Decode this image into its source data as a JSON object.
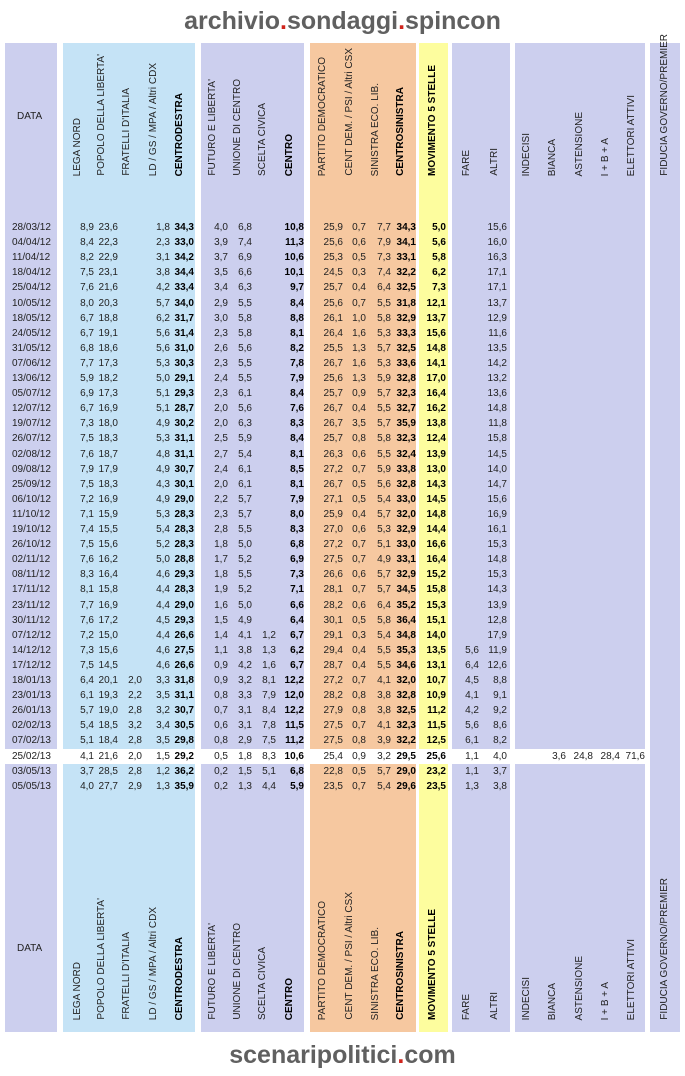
{
  "header": {
    "title_pre": "archivio",
    "title_mid": "sondaggi",
    "title_post": "spincon"
  },
  "footer": {
    "pre": "scenaripolitici",
    "post": "com"
  },
  "dot": ".",
  "headers": {
    "data": "DATA",
    "cdx": [
      "LEGA NORD",
      "POPOLO DELLA LIBERTA'",
      "FRATELLI D'ITALIA",
      "LD / GS / MPA / Altri CDX",
      "CENTRODESTRA"
    ],
    "centro": [
      "FUTURO E LIBERTA'",
      "UNIONE DI CENTRO",
      "SCELTA CIVICA",
      "CENTRO"
    ],
    "csx": [
      "PARTITO DEMOCRATICO",
      "CENT DEM. / PSI / Altri CSX",
      "SINISTRA ECO. LIB.",
      "CENTROSINISTRA"
    ],
    "m5s": "MOVIMENTO 5 STELLE",
    "altri": [
      "FARE",
      "ALTRI"
    ],
    "astensione": [
      "INDECISI",
      "BIANCA",
      "ASTENSIONE",
      "I + B + A",
      "ELETTORI ATTIVI"
    ],
    "fiducia": "FIDUCIA GOVERNO/PREMIER"
  },
  "colors": {
    "data_bg": "#cccfee",
    "cdx_bg": "#c5e3f6",
    "centro_bg": "#cccfee",
    "csx_bg": "#f6c8a0",
    "m5s_bg": "#fdfd9e",
    "altri_bg": "#cccfee",
    "ast_bg": "#cccfee",
    "fid_bg": "#cccfee",
    "highlight": "#ffffff"
  },
  "rows": [
    [
      "28/03/12",
      "8,9",
      "23,6",
      "",
      "1,8",
      "34,3",
      "4,0",
      "6,8",
      "",
      "10,8",
      "25,9",
      "0,7",
      "7,7",
      "34,3",
      "5,0",
      "",
      "15,6",
      "",
      "",
      "",
      "",
      "",
      ""
    ],
    [
      "04/04/12",
      "8,4",
      "22,3",
      "",
      "2,3",
      "33,0",
      "3,9",
      "7,4",
      "",
      "11,3",
      "25,6",
      "0,6",
      "7,9",
      "34,1",
      "5,6",
      "",
      "16,0",
      "",
      "",
      "",
      "",
      "",
      ""
    ],
    [
      "11/04/12",
      "8,2",
      "22,9",
      "",
      "3,1",
      "34,2",
      "3,7",
      "6,9",
      "",
      "10,6",
      "25,3",
      "0,5",
      "7,3",
      "33,1",
      "5,8",
      "",
      "16,3",
      "",
      "",
      "",
      "",
      "",
      ""
    ],
    [
      "18/04/12",
      "7,5",
      "23,1",
      "",
      "3,8",
      "34,4",
      "3,5",
      "6,6",
      "",
      "10,1",
      "24,5",
      "0,3",
      "7,4",
      "32,2",
      "6,2",
      "",
      "17,1",
      "",
      "",
      "",
      "",
      "",
      ""
    ],
    [
      "25/04/12",
      "7,6",
      "21,6",
      "",
      "4,2",
      "33,4",
      "3,4",
      "6,3",
      "",
      "9,7",
      "25,7",
      "0,4",
      "6,4",
      "32,5",
      "7,3",
      "",
      "17,1",
      "",
      "",
      "",
      "",
      "",
      ""
    ],
    [
      "10/05/12",
      "8,0",
      "20,3",
      "",
      "5,7",
      "34,0",
      "2,9",
      "5,5",
      "",
      "8,4",
      "25,6",
      "0,7",
      "5,5",
      "31,8",
      "12,1",
      "",
      "13,7",
      "",
      "",
      "",
      "",
      "",
      ""
    ],
    [
      "18/05/12",
      "6,7",
      "18,8",
      "",
      "6,2",
      "31,7",
      "3,0",
      "5,8",
      "",
      "8,8",
      "26,1",
      "1,0",
      "5,8",
      "32,9",
      "13,7",
      "",
      "12,9",
      "",
      "",
      "",
      "",
      "",
      ""
    ],
    [
      "24/05/12",
      "6,7",
      "19,1",
      "",
      "5,6",
      "31,4",
      "2,3",
      "5,8",
      "",
      "8,1",
      "26,4",
      "1,6",
      "5,3",
      "33,3",
      "15,6",
      "",
      "11,6",
      "",
      "",
      "",
      "",
      "",
      ""
    ],
    [
      "31/05/12",
      "6,8",
      "18,6",
      "",
      "5,6",
      "31,0",
      "2,6",
      "5,6",
      "",
      "8,2",
      "25,5",
      "1,3",
      "5,7",
      "32,5",
      "14,8",
      "",
      "13,5",
      "",
      "",
      "",
      "",
      "",
      ""
    ],
    [
      "07/06/12",
      "7,7",
      "17,3",
      "",
      "5,3",
      "30,3",
      "2,3",
      "5,5",
      "",
      "7,8",
      "26,7",
      "1,6",
      "5,3",
      "33,6",
      "14,1",
      "",
      "14,2",
      "",
      "",
      "",
      "",
      "",
      ""
    ],
    [
      "13/06/12",
      "5,9",
      "18,2",
      "",
      "5,0",
      "29,1",
      "2,4",
      "5,5",
      "",
      "7,9",
      "25,6",
      "1,3",
      "5,9",
      "32,8",
      "17,0",
      "",
      "13,2",
      "",
      "",
      "",
      "",
      "",
      ""
    ],
    [
      "05/07/12",
      "6,9",
      "17,3",
      "",
      "5,1",
      "29,3",
      "2,3",
      "6,1",
      "",
      "8,4",
      "25,7",
      "0,9",
      "5,7",
      "32,3",
      "16,4",
      "",
      "13,6",
      "",
      "",
      "",
      "",
      "",
      ""
    ],
    [
      "12/07/12",
      "6,7",
      "16,9",
      "",
      "5,1",
      "28,7",
      "2,0",
      "5,6",
      "",
      "7,6",
      "26,7",
      "0,4",
      "5,5",
      "32,7",
      "16,2",
      "",
      "14,8",
      "",
      "",
      "",
      "",
      "",
      ""
    ],
    [
      "19/07/12",
      "7,3",
      "18,0",
      "",
      "4,9",
      "30,2",
      "2,0",
      "6,3",
      "",
      "8,3",
      "26,7",
      "3,5",
      "5,7",
      "35,9",
      "13,8",
      "",
      "11,8",
      "",
      "",
      "",
      "",
      "",
      ""
    ],
    [
      "26/07/12",
      "7,5",
      "18,3",
      "",
      "5,3",
      "31,1",
      "2,5",
      "5,9",
      "",
      "8,4",
      "25,7",
      "0,8",
      "5,8",
      "32,3",
      "12,4",
      "",
      "15,8",
      "",
      "",
      "",
      "",
      "",
      ""
    ],
    [
      "02/08/12",
      "7,6",
      "18,7",
      "",
      "4,8",
      "31,1",
      "2,7",
      "5,4",
      "",
      "8,1",
      "26,3",
      "0,6",
      "5,5",
      "32,4",
      "13,9",
      "",
      "14,5",
      "",
      "",
      "",
      "",
      "",
      ""
    ],
    [
      "09/08/12",
      "7,9",
      "17,9",
      "",
      "4,9",
      "30,7",
      "2,4",
      "6,1",
      "",
      "8,5",
      "27,2",
      "0,7",
      "5,9",
      "33,8",
      "13,0",
      "",
      "14,0",
      "",
      "",
      "",
      "",
      "",
      ""
    ],
    [
      "25/09/12",
      "7,5",
      "18,3",
      "",
      "4,3",
      "30,1",
      "2,0",
      "6,1",
      "",
      "8,1",
      "26,7",
      "0,5",
      "5,6",
      "32,8",
      "14,3",
      "",
      "14,7",
      "",
      "",
      "",
      "",
      "",
      ""
    ],
    [
      "06/10/12",
      "7,2",
      "16,9",
      "",
      "4,9",
      "29,0",
      "2,2",
      "5,7",
      "",
      "7,9",
      "27,1",
      "0,5",
      "5,4",
      "33,0",
      "14,5",
      "",
      "15,6",
      "",
      "",
      "",
      "",
      "",
      ""
    ],
    [
      "11/10/12",
      "7,1",
      "15,9",
      "",
      "5,3",
      "28,3",
      "2,3",
      "5,7",
      "",
      "8,0",
      "25,9",
      "0,4",
      "5,7",
      "32,0",
      "14,8",
      "",
      "16,9",
      "",
      "",
      "",
      "",
      "",
      ""
    ],
    [
      "19/10/12",
      "7,4",
      "15,5",
      "",
      "5,4",
      "28,3",
      "2,8",
      "5,5",
      "",
      "8,3",
      "27,0",
      "0,6",
      "5,3",
      "32,9",
      "14,4",
      "",
      "16,1",
      "",
      "",
      "",
      "",
      "",
      ""
    ],
    [
      "26/10/12",
      "7,5",
      "15,6",
      "",
      "5,2",
      "28,3",
      "1,8",
      "5,0",
      "",
      "6,8",
      "27,2",
      "0,7",
      "5,1",
      "33,0",
      "16,6",
      "",
      "15,3",
      "",
      "",
      "",
      "",
      "",
      ""
    ],
    [
      "02/11/12",
      "7,6",
      "16,2",
      "",
      "5,0",
      "28,8",
      "1,7",
      "5,2",
      "",
      "6,9",
      "27,5",
      "0,7",
      "4,9",
      "33,1",
      "16,4",
      "",
      "14,8",
      "",
      "",
      "",
      "",
      "",
      ""
    ],
    [
      "08/11/12",
      "8,3",
      "16,4",
      "",
      "4,6",
      "29,3",
      "1,8",
      "5,5",
      "",
      "7,3",
      "26,6",
      "0,6",
      "5,7",
      "32,9",
      "15,2",
      "",
      "15,3",
      "",
      "",
      "",
      "",
      "",
      ""
    ],
    [
      "17/11/12",
      "8,1",
      "15,8",
      "",
      "4,4",
      "28,3",
      "1,9",
      "5,2",
      "",
      "7,1",
      "28,1",
      "0,7",
      "5,7",
      "34,5",
      "15,8",
      "",
      "14,3",
      "",
      "",
      "",
      "",
      "",
      ""
    ],
    [
      "23/11/12",
      "7,7",
      "16,9",
      "",
      "4,4",
      "29,0",
      "1,6",
      "5,0",
      "",
      "6,6",
      "28,2",
      "0,6",
      "6,4",
      "35,2",
      "15,3",
      "",
      "13,9",
      "",
      "",
      "",
      "",
      "",
      ""
    ],
    [
      "30/11/12",
      "7,6",
      "17,2",
      "",
      "4,5",
      "29,3",
      "1,5",
      "4,9",
      "",
      "6,4",
      "30,1",
      "0,5",
      "5,8",
      "36,4",
      "15,1",
      "",
      "12,8",
      "",
      "",
      "",
      "",
      "",
      ""
    ],
    [
      "07/12/12",
      "7,2",
      "15,0",
      "",
      "4,4",
      "26,6",
      "1,4",
      "4,1",
      "1,2",
      "6,7",
      "29,1",
      "0,3",
      "5,4",
      "34,8",
      "14,0",
      "",
      "17,9",
      "",
      "",
      "",
      "",
      "",
      ""
    ],
    [
      "14/12/12",
      "7,3",
      "15,6",
      "",
      "4,6",
      "27,5",
      "1,1",
      "3,8",
      "1,3",
      "6,2",
      "29,4",
      "0,4",
      "5,5",
      "35,3",
      "13,5",
      "5,6",
      "11,9",
      "",
      "",
      "",
      "",
      "",
      ""
    ],
    [
      "17/12/12",
      "7,5",
      "14,5",
      "",
      "4,6",
      "26,6",
      "0,9",
      "4,2",
      "1,6",
      "6,7",
      "28,7",
      "0,4",
      "5,5",
      "34,6",
      "13,1",
      "6,4",
      "12,6",
      "",
      "",
      "",
      "",
      "",
      ""
    ],
    [
      "18/01/13",
      "6,4",
      "20,1",
      "2,0",
      "3,3",
      "31,8",
      "0,9",
      "3,2",
      "8,1",
      "12,2",
      "27,2",
      "0,7",
      "4,1",
      "32,0",
      "10,7",
      "4,5",
      "8,8",
      "",
      "",
      "",
      "",
      "",
      ""
    ],
    [
      "23/01/13",
      "6,1",
      "19,3",
      "2,2",
      "3,5",
      "31,1",
      "0,8",
      "3,3",
      "7,9",
      "12,0",
      "28,2",
      "0,8",
      "3,8",
      "32,8",
      "10,9",
      "4,1",
      "9,1",
      "",
      "",
      "",
      "",
      "",
      ""
    ],
    [
      "26/01/13",
      "5,7",
      "19,0",
      "2,8",
      "3,2",
      "30,7",
      "0,7",
      "3,1",
      "8,4",
      "12,2",
      "27,9",
      "0,8",
      "3,8",
      "32,5",
      "11,2",
      "4,2",
      "9,2",
      "",
      "",
      "",
      "",
      "",
      ""
    ],
    [
      "02/02/13",
      "5,4",
      "18,5",
      "3,2",
      "3,4",
      "30,5",
      "0,6",
      "3,1",
      "7,8",
      "11,5",
      "27,5",
      "0,7",
      "4,1",
      "32,3",
      "11,5",
      "5,6",
      "8,6",
      "",
      "",
      "",
      "",
      "",
      ""
    ],
    [
      "07/02/13",
      "5,1",
      "18,4",
      "2,8",
      "3,5",
      "29,8",
      "0,8",
      "2,9",
      "7,5",
      "11,2",
      "27,5",
      "0,8",
      "3,9",
      "32,2",
      "12,5",
      "6,1",
      "8,2",
      "",
      "",
      "",
      "",
      "",
      ""
    ],
    [
      "25/02/13",
      "4,1",
      "21,6",
      "2,0",
      "1,5",
      "29,2",
      "0,5",
      "1,8",
      "8,3",
      "10,6",
      "25,4",
      "0,9",
      "3,2",
      "29,5",
      "25,6",
      "1,1",
      "4,0",
      "",
      "3,6",
      "24,8",
      "28,4",
      "71,6",
      ""
    ],
    [
      "03/05/13",
      "3,7",
      "28,5",
      "2,8",
      "1,2",
      "36,2",
      "0,2",
      "1,5",
      "5,1",
      "6,8",
      "22,8",
      "0,5",
      "5,7",
      "29,0",
      "23,2",
      "1,1",
      "3,7",
      "",
      "",
      "",
      "",
      "",
      ""
    ],
    [
      "05/05/13",
      "4,0",
      "27,7",
      "2,9",
      "1,3",
      "35,9",
      "0,2",
      "1,3",
      "4,4",
      "5,9",
      "23,5",
      "0,7",
      "5,4",
      "29,6",
      "23,5",
      "1,3",
      "3,8",
      "",
      "",
      "",
      "",
      "",
      ""
    ]
  ]
}
